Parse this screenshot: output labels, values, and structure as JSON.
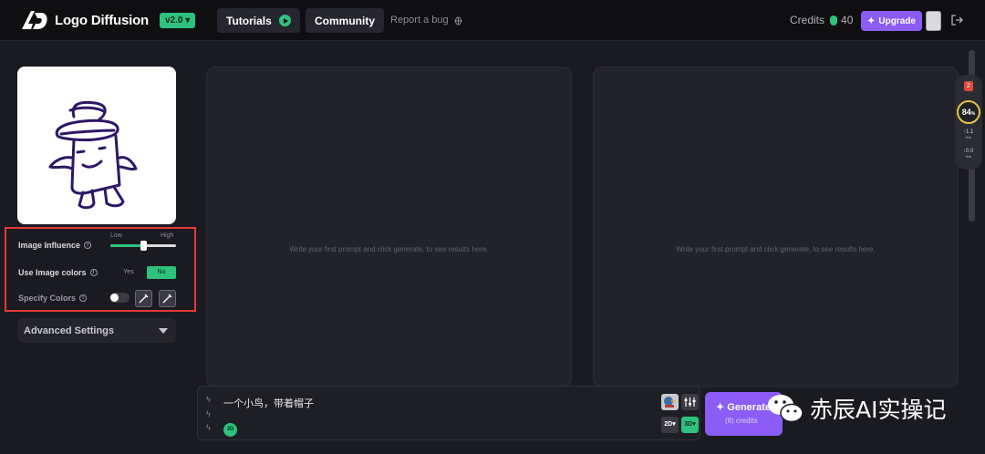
{
  "header": {
    "brand": "Logo Diffusion",
    "version": "v2.0 ▾",
    "tutorials": "Tutorials",
    "community": "Community",
    "report_bug": "Report a bug",
    "credits_label": "Credits",
    "credits_value": "40",
    "upgrade": "Upgrade"
  },
  "left": {
    "image_influence": "Image Influence",
    "influence_low": "Low",
    "influence_high": "High",
    "influence_level": 0.5,
    "use_image_colors": "Use Image colors",
    "yes": "Yes",
    "no": "No",
    "specify_colors": "Specify Colors",
    "advanced": "Advanced Settings"
  },
  "panels": {
    "left_placeholder": "Write your first prompt and click generate, to see results here.",
    "right_placeholder": "Write your first prompt and click generate, to see results here."
  },
  "prompt": {
    "text": "一个小鸟，带着帽子",
    "badge": "3D",
    "btn_2d": "2D▾",
    "btn_3d": "3D▾",
    "generate": "Generate",
    "generate_cost": "(8) credits"
  },
  "widget": {
    "alert": "2",
    "percent": "84",
    "percent_unit": "%",
    "up_value": "1.1",
    "up_unit": "K/s",
    "down_value": "0.0",
    "down_unit": "K/s"
  },
  "watermark": "赤辰AI实操记",
  "colors": {
    "accent_green": "#2ec27e",
    "accent_purple": "#8b5cf6",
    "highlight_red": "#e53935",
    "sketch_ink": "#2d1766"
  }
}
